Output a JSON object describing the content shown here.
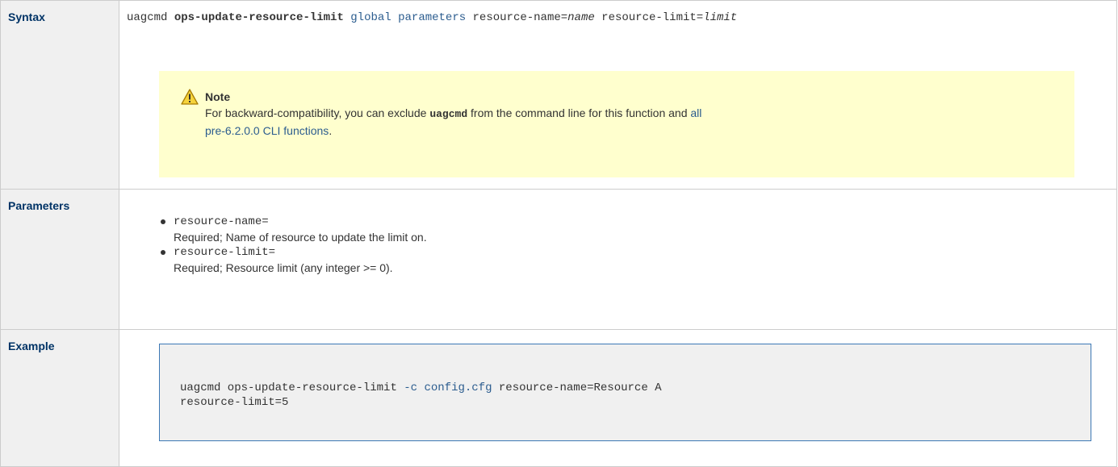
{
  "colors": {
    "header_bg": "#f0f0f0",
    "header_text": "#003366",
    "border": "#cccccc",
    "note_bg": "#ffffce",
    "link": "#2c5d8f",
    "code_border": "#3c78b5",
    "code_bg": "#f0f0f0"
  },
  "syntax": {
    "header": "Syntax",
    "cmd": "uagcmd",
    "function": "ops-update-resource-limit",
    "global": "global",
    "parameters": "parameters",
    "arg1_name": "resource-name=",
    "arg1_value": "name",
    "arg2_name": "resource-limit=",
    "arg2_value": "limit",
    "note": {
      "icon": "warning-icon",
      "title": "Note",
      "text_before": "For backward-compatibility, you can exclude ",
      "code": "uagcmd",
      "text_middle": " from the command line for this function and ",
      "link_line1": "all",
      "link_line2": "pre-6.2.0.0 CLI functions",
      "text_after": "."
    }
  },
  "parameters": {
    "header": "Parameters",
    "items": [
      {
        "name": "resource-name=",
        "description": "Required; Name of resource to update the limit on."
      },
      {
        "name": "resource-limit=",
        "description": "Required; Resource limit (any integer >= 0)."
      }
    ]
  },
  "example": {
    "header": "Example",
    "line1_prefix": "uagcmd ops-update-resource-limit ",
    "line1_flag": "-c",
    "line1_file": "config.cfg",
    "line1_suffix": " resource-name=Resource A",
    "line2": "resource-limit=5"
  }
}
